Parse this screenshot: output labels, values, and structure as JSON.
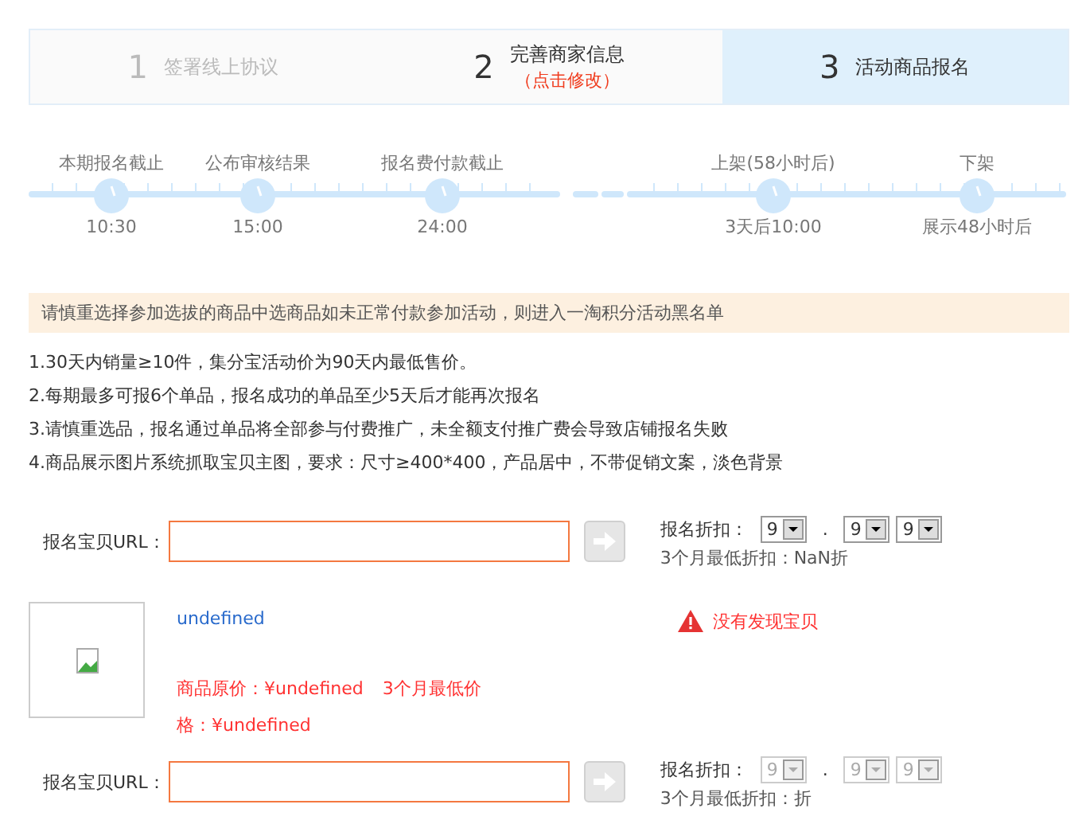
{
  "steps": [
    {
      "number": "1",
      "label": "签署线上协议",
      "muted": true,
      "selected": false
    },
    {
      "number": "2",
      "label": "完善商家信息",
      "note": "（点击修改）",
      "muted": false,
      "selected": false
    },
    {
      "number": "3",
      "label": "活动商品报名",
      "muted": false,
      "selected": true
    }
  ],
  "timeline": [
    {
      "above": "本期报名截止",
      "below": "10:30"
    },
    {
      "above": "公布审核结果",
      "below": "15:00"
    },
    {
      "above": "报名费付款截止",
      "below": "24:00"
    },
    {
      "above": "上架(58小时后)",
      "below": "3天后10:00"
    },
    {
      "above": "下架",
      "below": "展示48小时后"
    }
  ],
  "notice": "请慎重选择参加选拔的商品中选商品如未正常付款参加活动，则进入一淘积分活动黑名单",
  "rules": [
    "1.30天内销量≥10件，集分宝活动价为90天内最低售价。",
    "2.每期最多可报6个单品，报名成功的单品至少5天后才能再次报名",
    "3.请慎重选品，报名通过单品将全部参与付费推广，未全额支付推广费会导致店铺报名失败",
    "4.商品展示图片系统抓取宝贝主图，要求：尺寸≥400*400，产品居中，不带促销文案，淡色背景"
  ],
  "entries": [
    {
      "url_label": "报名宝贝URL：",
      "discount_label": "报名折扣：",
      "digits": [
        "9",
        "9",
        "9"
      ],
      "separator": ".",
      "disabled": false,
      "lowest": "3个月最低折扣：NaN折",
      "product": {
        "title": "undefined",
        "price_line": "商品原价：¥undefined",
        "lowest_label": "3个月最低价",
        "price_line_2": "格：¥undefined",
        "warning": "没有发现宝贝"
      }
    },
    {
      "url_label": "报名宝贝URL：",
      "discount_label": "报名折扣：",
      "digits": [
        "9",
        "9",
        "9"
      ],
      "separator": ".",
      "disabled": true,
      "lowest": "3个月最低折扣：折"
    }
  ]
}
